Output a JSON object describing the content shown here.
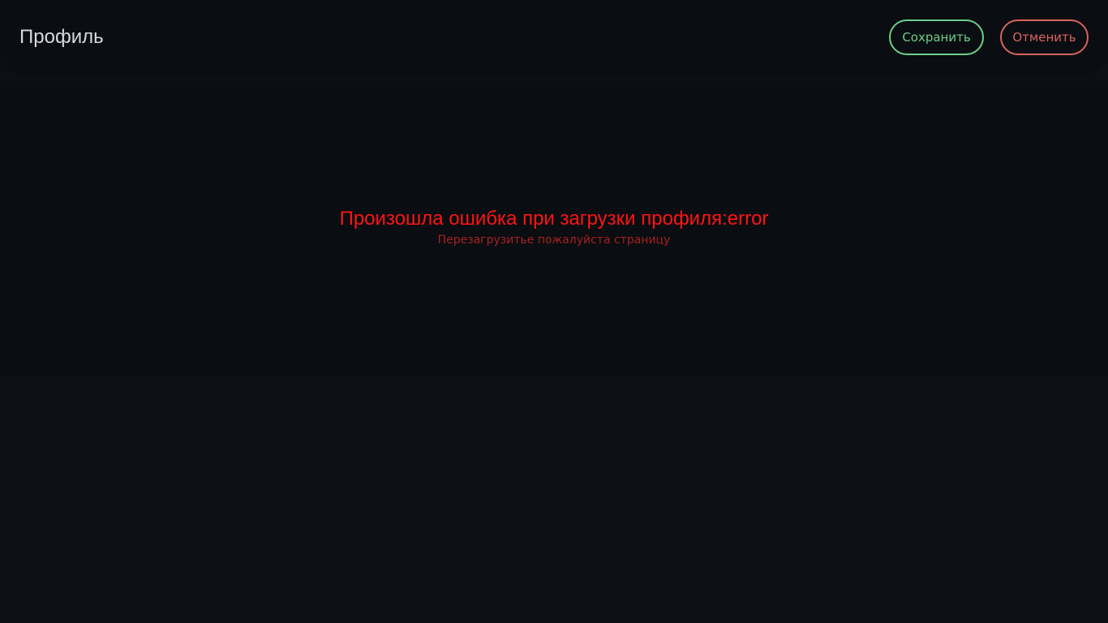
{
  "header": {
    "title": "Профиль",
    "save_label": "Сохранить",
    "cancel_label": "Отменить"
  },
  "error": {
    "title": "Произошла ошибка при загрузки профиля:error",
    "hint": "Перезагрузитье пожалуйста страницу"
  },
  "colors": {
    "background": "#0c1014",
    "panel": "#0a0d11",
    "save_accent": "#6ccf8a",
    "cancel_accent": "#d8645f",
    "error_title": "#ff1414",
    "error_hint": "#a82020"
  }
}
